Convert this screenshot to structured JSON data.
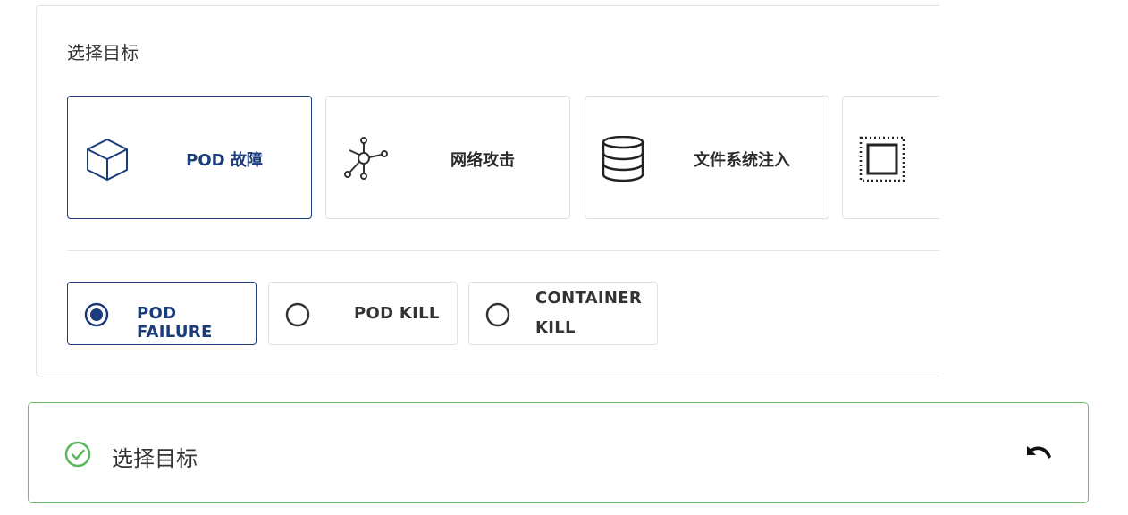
{
  "panel": {
    "title": "选择目标",
    "targets": [
      {
        "label": "POD 故障",
        "icon": "cube-icon",
        "selected": true
      },
      {
        "label": "网络攻击",
        "icon": "network-icon",
        "selected": false
      },
      {
        "label": "文件系统注入",
        "icon": "database-icon",
        "selected": false
      },
      {
        "label": "",
        "icon": "dotted-square-icon",
        "selected": false
      }
    ],
    "options": [
      {
        "label": "POD FAILURE",
        "selected": true
      },
      {
        "label": "POD KILL",
        "selected": false
      },
      {
        "label_line1": "CONTAINER",
        "label_line2": "KILL",
        "selected": false
      }
    ]
  },
  "summary": {
    "text": "选择目标",
    "status_icon": "check-circle-icon",
    "action_icon": "undo-icon"
  },
  "colors": {
    "accent": "#1a3c7a",
    "success": "#5cb85c",
    "border": "#e0e0e0"
  }
}
